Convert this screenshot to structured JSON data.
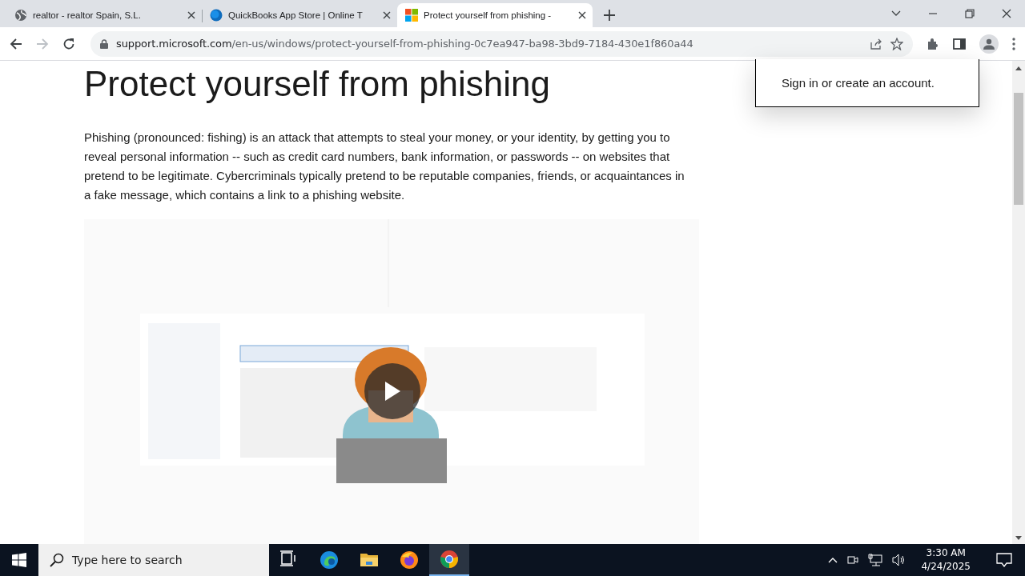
{
  "tabs": [
    {
      "kind": "globe",
      "title": "realtor - realtor Spain, S.L.",
      "selected": false
    },
    {
      "kind": "blue-dot",
      "title": "QuickBooks App Store | Online T",
      "selected": false
    },
    {
      "kind": "four-squares",
      "title": "Protect yourself from phishing -",
      "selected": true
    }
  ],
  "address": {
    "host": "support.microsoft.com",
    "path": "/en-us/windows/protect-yourself-from-phishing-0c7ea947-ba98-3bd9-7184-430e1f860a44"
  },
  "article": {
    "heading": "Protect yourself from phishing",
    "paragraph": "Phishing (pronounced: fishing) is an attack that attempts to steal your money, or your identity, by getting you to reveal personal information -- such as credit card numbers, bank information, or passwords -- on websites that pretend to be legitimate. Cybercriminals typically pretend to be reputable companies, friends, or acquaintances in a fake message, which contains a link to a phishing website."
  },
  "account_popup": {
    "text": "Sign in or create an account."
  },
  "taskbar": {
    "search_placeholder": "Type here to search",
    "apps": [
      {
        "kind": "task-view",
        "selected": false
      },
      {
        "kind": "edge",
        "selected": false
      },
      {
        "kind": "folder",
        "selected": false
      },
      {
        "kind": "firefox",
        "selected": false
      },
      {
        "kind": "chrome",
        "selected": true
      }
    ],
    "time": "3:30 AM",
    "date": "4/24/2025"
  }
}
